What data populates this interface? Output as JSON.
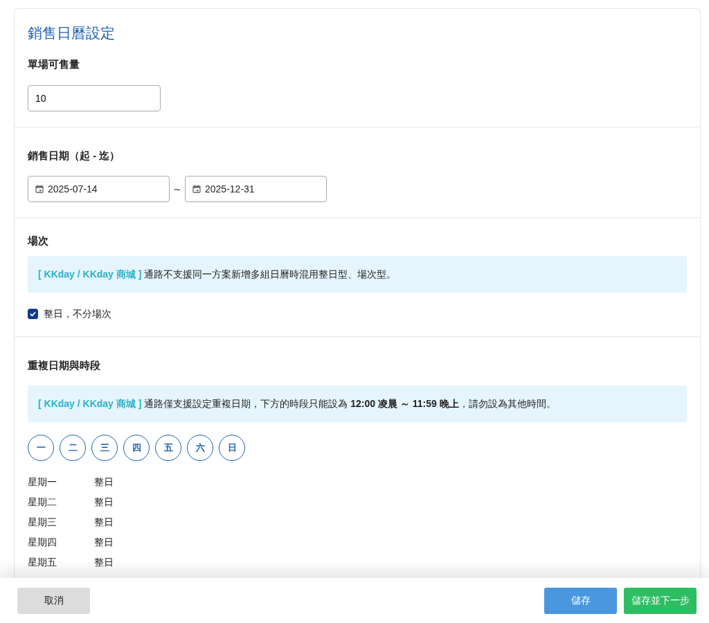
{
  "title": "銷售日曆設定",
  "quantity": {
    "label": "單場可售量",
    "value": "10"
  },
  "sale_dates": {
    "label": "銷售日期（起 - 迄）",
    "start": "2025-07-14",
    "separator": "～",
    "end": "2025-12-31"
  },
  "sessions": {
    "label": "場次",
    "notice": {
      "tag": "[ KKday / KKday 商城 ]",
      "message": "通路不支援同一方案新增多組日曆時混用整日型、場次型。"
    },
    "checkbox": {
      "label": "整日，不分場次",
      "checked": true
    }
  },
  "repeat": {
    "label": "重複日期與時段",
    "notice": {
      "tag": "[ KKday / KKday 商城 ]",
      "message": "通路僅支援設定重複日期，下方的時段只能設為 **12:00 凌晨 ～ 11:59 晚上**，請勿設為其他時間。"
    },
    "days": [
      {
        "label": "一",
        "selected": false
      },
      {
        "label": "二",
        "selected": false
      },
      {
        "label": "三",
        "selected": false
      },
      {
        "label": "四",
        "selected": false
      },
      {
        "label": "五",
        "selected": false
      },
      {
        "label": "六",
        "selected": false
      },
      {
        "label": "日",
        "selected": false
      }
    ],
    "schedule": [
      {
        "day": "星期一",
        "time": "整日"
      },
      {
        "day": "星期二",
        "time": "整日"
      },
      {
        "day": "星期三",
        "time": "整日"
      },
      {
        "day": "星期四",
        "time": "整日"
      },
      {
        "day": "星期五",
        "time": "整日"
      }
    ]
  },
  "buttons": [
    {
      "label": "取消",
      "kind": "cancel"
    },
    {
      "label": "儲存",
      "kind": "save"
    },
    {
      "label": "儲存並下一步",
      "kind": "next"
    }
  ]
}
